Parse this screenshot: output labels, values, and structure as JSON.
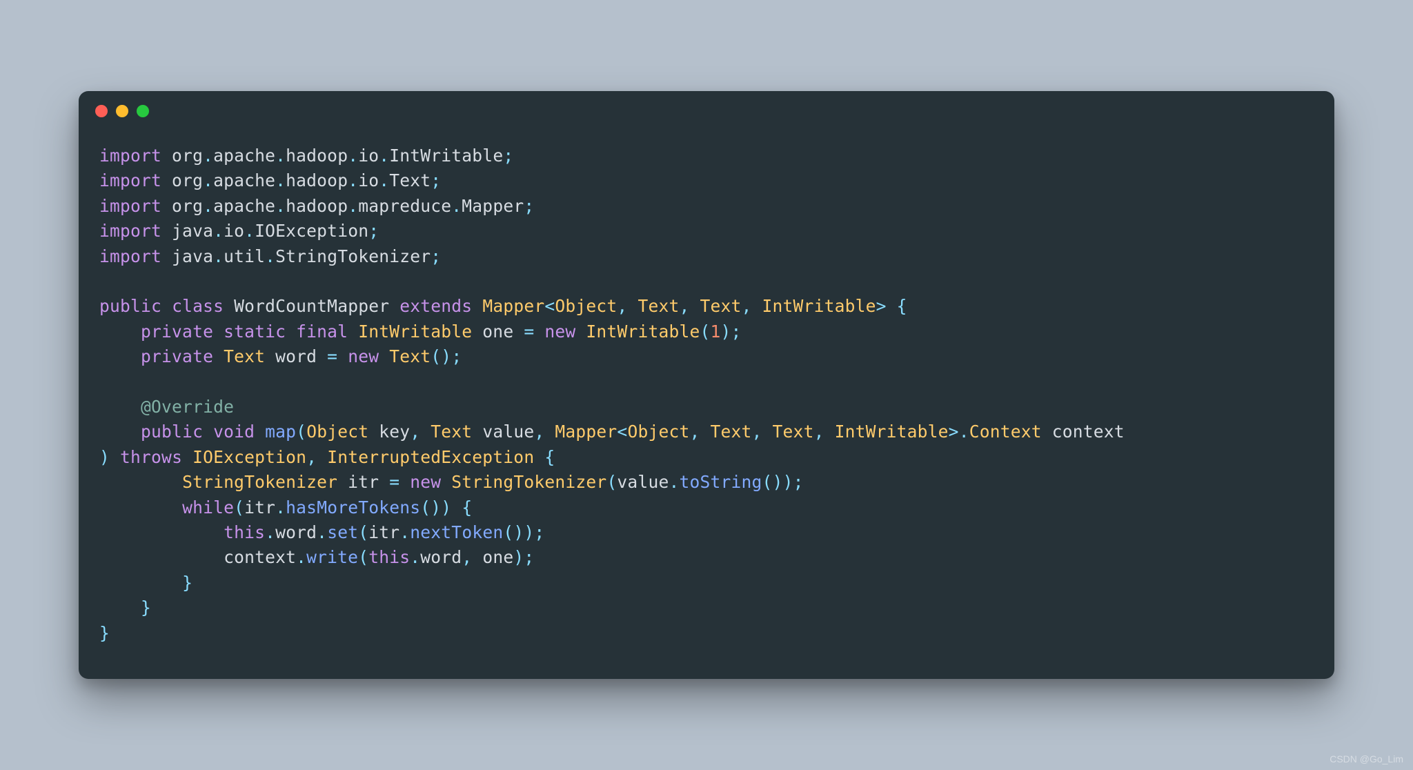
{
  "traffic_lights": [
    "red",
    "yellow",
    "green"
  ],
  "colors": {
    "page_bg": "#b5c0cc",
    "window_bg": "#263238",
    "red": "#ff5f56",
    "yellow": "#ffbd2e",
    "green": "#27c93f",
    "keyword": "#c792ea",
    "type": "#ffcb6b",
    "function": "#82aaff",
    "variable": "#d7dce2",
    "punctuation": "#89ddff",
    "number": "#f78c6c",
    "annotation": "#82b1a6"
  },
  "watermark": "CSDN @Go_Lim",
  "code_lines": [
    [
      [
        "kw",
        "import"
      ],
      [
        "var",
        " org"
      ],
      [
        "punc",
        "."
      ],
      [
        "var",
        "apache"
      ],
      [
        "punc",
        "."
      ],
      [
        "var",
        "hadoop"
      ],
      [
        "punc",
        "."
      ],
      [
        "var",
        "io"
      ],
      [
        "punc",
        "."
      ],
      [
        "var",
        "IntWritable"
      ],
      [
        "punc",
        ";"
      ]
    ],
    [
      [
        "kw",
        "import"
      ],
      [
        "var",
        " org"
      ],
      [
        "punc",
        "."
      ],
      [
        "var",
        "apache"
      ],
      [
        "punc",
        "."
      ],
      [
        "var",
        "hadoop"
      ],
      [
        "punc",
        "."
      ],
      [
        "var",
        "io"
      ],
      [
        "punc",
        "."
      ],
      [
        "var",
        "Text"
      ],
      [
        "punc",
        ";"
      ]
    ],
    [
      [
        "kw",
        "import"
      ],
      [
        "var",
        " org"
      ],
      [
        "punc",
        "."
      ],
      [
        "var",
        "apache"
      ],
      [
        "punc",
        "."
      ],
      [
        "var",
        "hadoop"
      ],
      [
        "punc",
        "."
      ],
      [
        "var",
        "mapreduce"
      ],
      [
        "punc",
        "."
      ],
      [
        "var",
        "Mapper"
      ],
      [
        "punc",
        ";"
      ]
    ],
    [
      [
        "kw",
        "import"
      ],
      [
        "var",
        " java"
      ],
      [
        "punc",
        "."
      ],
      [
        "var",
        "io"
      ],
      [
        "punc",
        "."
      ],
      [
        "var",
        "IOException"
      ],
      [
        "punc",
        ";"
      ]
    ],
    [
      [
        "kw",
        "import"
      ],
      [
        "var",
        " java"
      ],
      [
        "punc",
        "."
      ],
      [
        "var",
        "util"
      ],
      [
        "punc",
        "."
      ],
      [
        "var",
        "StringTokenizer"
      ],
      [
        "punc",
        ";"
      ]
    ],
    [],
    [
      [
        "kw",
        "public"
      ],
      [
        "var",
        " "
      ],
      [
        "kw",
        "class"
      ],
      [
        "var",
        " "
      ],
      [
        "cname",
        "WordCountMapper"
      ],
      [
        "var",
        " "
      ],
      [
        "kw",
        "extends"
      ],
      [
        "var",
        " "
      ],
      [
        "type",
        "Mapper"
      ],
      [
        "punc",
        "<"
      ],
      [
        "type",
        "Object"
      ],
      [
        "punc",
        ", "
      ],
      [
        "type",
        "Text"
      ],
      [
        "punc",
        ", "
      ],
      [
        "type",
        "Text"
      ],
      [
        "punc",
        ", "
      ],
      [
        "type",
        "IntWritable"
      ],
      [
        "punc",
        ">"
      ],
      [
        "var",
        " "
      ],
      [
        "punc",
        "{"
      ]
    ],
    [
      [
        "var",
        "    "
      ],
      [
        "kw",
        "private"
      ],
      [
        "var",
        " "
      ],
      [
        "kw",
        "static"
      ],
      [
        "var",
        " "
      ],
      [
        "kw",
        "final"
      ],
      [
        "var",
        " "
      ],
      [
        "type",
        "IntWritable"
      ],
      [
        "var",
        " one "
      ],
      [
        "punc",
        "="
      ],
      [
        "var",
        " "
      ],
      [
        "kw",
        "new"
      ],
      [
        "var",
        " "
      ],
      [
        "type",
        "IntWritable"
      ],
      [
        "punc",
        "("
      ],
      [
        "num",
        "1"
      ],
      [
        "punc",
        ")"
      ],
      [
        "punc",
        ";"
      ]
    ],
    [
      [
        "var",
        "    "
      ],
      [
        "kw",
        "private"
      ],
      [
        "var",
        " "
      ],
      [
        "type",
        "Text"
      ],
      [
        "var",
        " word "
      ],
      [
        "punc",
        "="
      ],
      [
        "var",
        " "
      ],
      [
        "kw",
        "new"
      ],
      [
        "var",
        " "
      ],
      [
        "type",
        "Text"
      ],
      [
        "punc",
        "("
      ],
      [
        "punc",
        ")"
      ],
      [
        "punc",
        ";"
      ]
    ],
    [],
    [
      [
        "var",
        "    "
      ],
      [
        "ann",
        "@Override"
      ]
    ],
    [
      [
        "var",
        "    "
      ],
      [
        "kw",
        "public"
      ],
      [
        "var",
        " "
      ],
      [
        "kw",
        "void"
      ],
      [
        "var",
        " "
      ],
      [
        "fn",
        "map"
      ],
      [
        "punc",
        "("
      ],
      [
        "type",
        "Object"
      ],
      [
        "var",
        " key"
      ],
      [
        "punc",
        ", "
      ],
      [
        "type",
        "Text"
      ],
      [
        "var",
        " value"
      ],
      [
        "punc",
        ", "
      ],
      [
        "type",
        "Mapper"
      ],
      [
        "punc",
        "<"
      ],
      [
        "type",
        "Object"
      ],
      [
        "punc",
        ", "
      ],
      [
        "type",
        "Text"
      ],
      [
        "punc",
        ", "
      ],
      [
        "type",
        "Text"
      ],
      [
        "punc",
        ", "
      ],
      [
        "type",
        "IntWritable"
      ],
      [
        "punc",
        ">"
      ],
      [
        "punc",
        "."
      ],
      [
        "type",
        "Context"
      ],
      [
        "var",
        " context"
      ],
      [
        "punc",
        ")"
      ],
      [
        "var",
        " "
      ],
      [
        "kw",
        "throws"
      ],
      [
        "var",
        " "
      ],
      [
        "type",
        "IOException"
      ],
      [
        "punc",
        ", "
      ],
      [
        "type",
        "InterruptedException"
      ],
      [
        "var",
        " "
      ],
      [
        "punc",
        "{"
      ]
    ],
    [
      [
        "var",
        "        "
      ],
      [
        "type",
        "StringTokenizer"
      ],
      [
        "var",
        " itr "
      ],
      [
        "punc",
        "="
      ],
      [
        "var",
        " "
      ],
      [
        "kw",
        "new"
      ],
      [
        "var",
        " "
      ],
      [
        "type",
        "StringTokenizer"
      ],
      [
        "punc",
        "("
      ],
      [
        "var",
        "value"
      ],
      [
        "punc",
        "."
      ],
      [
        "fn",
        "toString"
      ],
      [
        "punc",
        "("
      ],
      [
        "punc",
        ")"
      ],
      [
        "punc",
        ")"
      ],
      [
        "punc",
        ";"
      ]
    ],
    [
      [
        "var",
        "        "
      ],
      [
        "kw",
        "while"
      ],
      [
        "punc",
        "("
      ],
      [
        "var",
        "itr"
      ],
      [
        "punc",
        "."
      ],
      [
        "fn",
        "hasMoreTokens"
      ],
      [
        "punc",
        "("
      ],
      [
        "punc",
        ")"
      ],
      [
        "punc",
        ")"
      ],
      [
        "var",
        " "
      ],
      [
        "punc",
        "{"
      ]
    ],
    [
      [
        "var",
        "            "
      ],
      [
        "kw",
        "this"
      ],
      [
        "punc",
        "."
      ],
      [
        "var",
        "word"
      ],
      [
        "punc",
        "."
      ],
      [
        "fn",
        "set"
      ],
      [
        "punc",
        "("
      ],
      [
        "var",
        "itr"
      ],
      [
        "punc",
        "."
      ],
      [
        "fn",
        "nextToken"
      ],
      [
        "punc",
        "("
      ],
      [
        "punc",
        ")"
      ],
      [
        "punc",
        ")"
      ],
      [
        "punc",
        ";"
      ]
    ],
    [
      [
        "var",
        "            "
      ],
      [
        "var",
        "context"
      ],
      [
        "punc",
        "."
      ],
      [
        "fn",
        "write"
      ],
      [
        "punc",
        "("
      ],
      [
        "kw",
        "this"
      ],
      [
        "punc",
        "."
      ],
      [
        "var",
        "word"
      ],
      [
        "punc",
        ", "
      ],
      [
        "var",
        "one"
      ],
      [
        "punc",
        ")"
      ],
      [
        "punc",
        ";"
      ]
    ],
    [
      [
        "var",
        "        "
      ],
      [
        "punc",
        "}"
      ]
    ],
    [
      [
        "var",
        "    "
      ],
      [
        "punc",
        "}"
      ]
    ],
    [
      [
        "punc",
        "}"
      ]
    ]
  ],
  "wrap_width_chars": 99
}
